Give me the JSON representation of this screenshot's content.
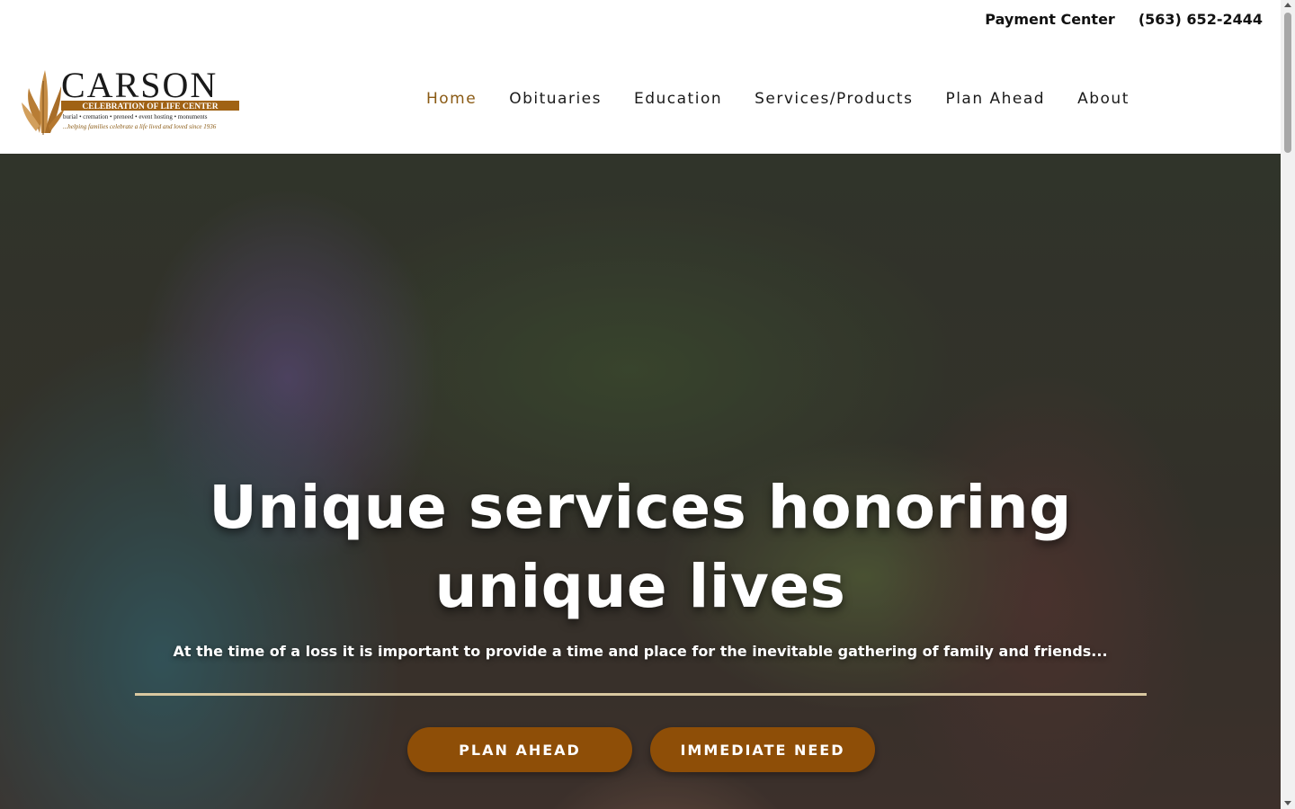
{
  "topbar": {
    "payment_center": "Payment Center",
    "phone": "(563) 652-2444"
  },
  "logo": {
    "name": "CARSON",
    "banner": "CELEBRATION OF LIFE CENTER",
    "services": "burial • cremation • preneed • event hosting • monuments",
    "tagline": "...helping families celebrate a life lived and loved since 1936",
    "icon": "wheat-sheaf-icon"
  },
  "nav": {
    "items": [
      {
        "label": "Home",
        "active": true
      },
      {
        "label": "Obituaries",
        "active": false
      },
      {
        "label": "Education",
        "active": false
      },
      {
        "label": "Services/Products",
        "active": false
      },
      {
        "label": "Plan Ahead",
        "active": false
      },
      {
        "label": "About",
        "active": false
      }
    ]
  },
  "hero": {
    "title": "Unique services honoring unique lives",
    "subtitle": "At the time of a loss it is important to provide a time and place for the inevitable gathering of family and friends...",
    "buttons": {
      "plan_ahead": "PLAN AHEAD",
      "immediate_need": "IMMEDIATE NEED"
    }
  },
  "colors": {
    "accent": "#8e4e07",
    "nav_active": "#8a5a14",
    "divider": "#d9c8a0"
  }
}
